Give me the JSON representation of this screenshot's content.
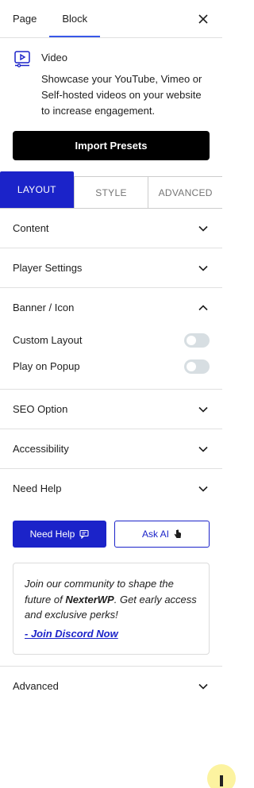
{
  "header": {
    "tabs": [
      {
        "label": "Page",
        "active": false
      },
      {
        "label": "Block",
        "active": true
      }
    ],
    "close_icon": "close-icon"
  },
  "block": {
    "title": "Video",
    "description": "Showcase your YouTube, Vimeo or Self-hosted videos on your website to increase engagement.",
    "icon": "video-icon"
  },
  "import_presets": "Import Presets",
  "mode_tabs": [
    {
      "label": "LAYOUT",
      "active": true
    },
    {
      "label": "STYLE",
      "active": false
    },
    {
      "label": "ADVANCED",
      "active": false
    }
  ],
  "sections": {
    "content": "Content",
    "player_settings": "Player Settings",
    "banner_icon": "Banner / Icon",
    "seo_option": "SEO Option",
    "accessibility": "Accessibility",
    "need_help": "Need Help",
    "advanced": "Advanced"
  },
  "banner_toggles": [
    {
      "label": "Custom Layout",
      "on": false
    },
    {
      "label": "Play on Popup",
      "on": false
    }
  ],
  "help": {
    "need_help_button": "Need Help",
    "ask_ai_button": "Ask AI"
  },
  "community": {
    "text_pre": "Join our community to shape the future of ",
    "brand": "NexterWP",
    "text_post": ". Get early access and exclusive perks!",
    "link": "- Join Discord Now"
  },
  "colors": {
    "accent": "#1b23c9",
    "tab_indicator": "#3858e9"
  }
}
